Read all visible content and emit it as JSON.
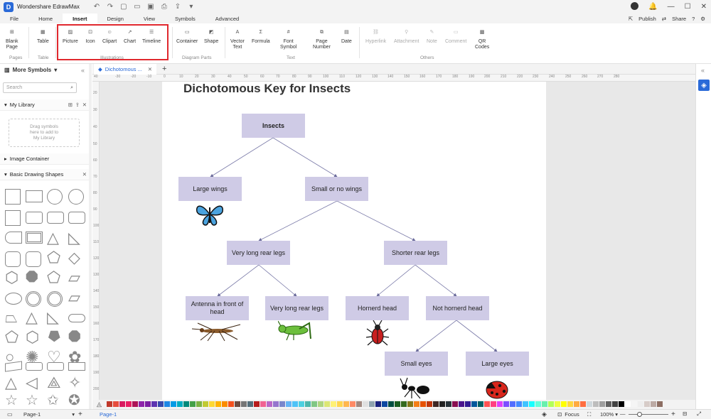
{
  "app": {
    "name": "Wondershare EdrawMax",
    "logo_letter": "D"
  },
  "menu": {
    "tabs": [
      "File",
      "Home",
      "Insert",
      "Design",
      "View",
      "Symbols",
      "Advanced"
    ],
    "active_tab": "Insert",
    "publish": "Publish",
    "share": "Share"
  },
  "ribbon": {
    "blank_page": "Blank\nPage",
    "table": "Table",
    "picture": "Picture",
    "icon": "Icon",
    "clipart": "Clipart",
    "chart": "Chart",
    "timeline": "Timeline",
    "container": "Container",
    "shape": "Shape",
    "vector_text": "Vector\nText",
    "formula": "Formula",
    "font_symbol": "Font\nSymbol",
    "page_number": "Page\nNumber",
    "date": "Date",
    "hyperlink": "Hyperlink",
    "attachment": "Attachment",
    "note": "Note",
    "comment": "Comment",
    "qr_codes": "QR\nCodes",
    "groups": {
      "pages": "Pages",
      "table": "Table",
      "illustrations": "Illustrations",
      "diagram_parts": "Diagram Parts",
      "text": "Text",
      "others": "Others"
    }
  },
  "sidebar": {
    "title": "More Symbols",
    "search_placeholder": "Search",
    "my_library": "My Library",
    "library_hint": "Drag symbols\nhere to add to\nMy Library",
    "image_container": "Image Container",
    "basic_shapes": "Basic Drawing Shapes"
  },
  "document": {
    "tab_name": "Dichotomous ..."
  },
  "rulers": {
    "h": [
      "40",
      "-30",
      "-20",
      "-10",
      "0",
      "10",
      "20",
      "30",
      "40",
      "50",
      "60",
      "70",
      "80",
      "90",
      "100",
      "110",
      "120",
      "130",
      "140",
      "150",
      "160",
      "170",
      "180",
      "190",
      "200",
      "210",
      "220",
      "230",
      "240",
      "250",
      "260",
      "270",
      "280"
    ],
    "v": [
      "20",
      "30",
      "40",
      "50",
      "60",
      "70",
      "80",
      "90",
      "100",
      "110",
      "120",
      "130",
      "140",
      "150",
      "160",
      "170",
      "180",
      "190",
      "200"
    ]
  },
  "diagram": {
    "title": "Dichotomous Key for Insects",
    "nodes": {
      "insects": "Insects",
      "large_wings": "Large wings",
      "small_wings": "Small or no wings",
      "long_legs": "Very long rear legs",
      "shorter_legs": "Shorter rear legs",
      "antenna": "Antenna in front of head",
      "long_legs2": "Very long rear legs",
      "hornerd": "Hornerd head",
      "not_hornerd": "Not hornerd head",
      "small_eyes": "Small eyes",
      "large_eyes": "Large eyes"
    },
    "node_color": "#cfcbe6"
  },
  "palette": [
    "#c0392b",
    "#e74c3c",
    "#d81b60",
    "#e91e63",
    "#ad1457",
    "#8e24aa",
    "#7b1fa2",
    "#5e35b1",
    "#3949ab",
    "#1e88e5",
    "#039be5",
    "#00acc1",
    "#00897b",
    "#43a047",
    "#7cb342",
    "#c0ca33",
    "#fdd835",
    "#ffb300",
    "#fb8c00",
    "#f4511e",
    "#6d4c41",
    "#757575",
    "#546e7a",
    "#b71c1c",
    "#f06292",
    "#ba68c8",
    "#9575cd",
    "#7986cb",
    "#64b5f6",
    "#4fc3f7",
    "#4dd0e1",
    "#4db6ac",
    "#81c784",
    "#aed581",
    "#dce775",
    "#fff176",
    "#ffd54f",
    "#ffb74d",
    "#ff8a65",
    "#a1887f",
    "#e0e0e0",
    "#90a4ae",
    "#1a237e",
    "#0d47a1",
    "#004d40",
    "#1b5e20",
    "#33691e",
    "#827717",
    "#f57f17",
    "#e65100",
    "#bf360c",
    "#3e2723",
    "#212121",
    "#263238",
    "#880e4f",
    "#4a148c",
    "#311b92",
    "#01579b",
    "#006064",
    "#ff5252",
    "#ff4081",
    "#e040fb",
    "#7c4dff",
    "#536dfe",
    "#448aff",
    "#40c4ff",
    "#18ffff",
    "#64ffda",
    "#69f0ae",
    "#b2ff59",
    "#eeff41",
    "#ffff00",
    "#ffd740",
    "#ffab40",
    "#ff6e40",
    "#cfd8dc",
    "#bdbdbd",
    "#9e9e9e",
    "#616161",
    "#424242",
    "#000000",
    "#ffffff",
    "#f5f5f5",
    "#eeeeee",
    "#d7ccc8",
    "#bcaaa4",
    "#8d6e63"
  ],
  "status": {
    "page_selector": "Page-1",
    "page_tab": "Page-1",
    "focus": "Focus",
    "zoom": "100%"
  }
}
